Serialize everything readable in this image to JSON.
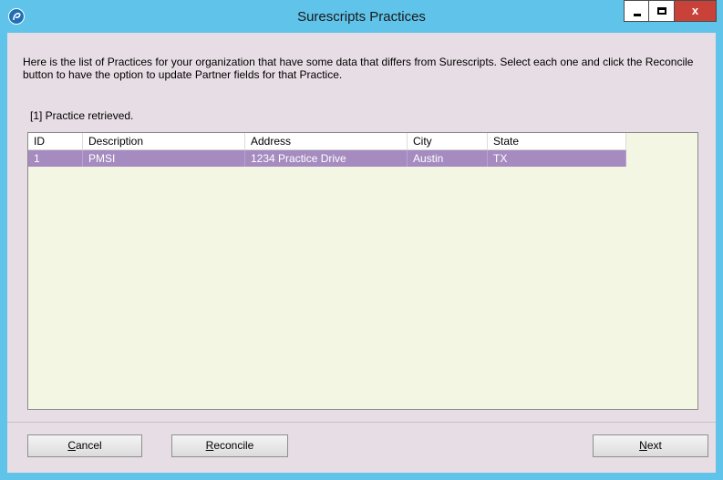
{
  "window": {
    "title": "Surescripts Practices",
    "close_glyph": "x"
  },
  "description": "Here is the list of Practices for your organization that have some data that differs from Surescripts. Select each one and click the Reconcile button to have the option to update Partner fields for that Practice.",
  "status": "[1] Practice retrieved.",
  "table": {
    "columns": [
      "ID",
      "Description",
      "Address",
      "City",
      "State"
    ],
    "rows": [
      [
        "1",
        "PMSI",
        "1234 Practice Drive",
        "Austin",
        "TX"
      ]
    ],
    "selected_row_color": "#a58bbf"
  },
  "buttons": {
    "cancel": {
      "first": "C",
      "rest": "ancel"
    },
    "reconcile": {
      "first": "R",
      "rest": "econcile"
    },
    "next": {
      "first": "N",
      "rest": "ext"
    }
  },
  "colors": {
    "titlebar": "#5fc3ea",
    "client_bg": "#e7dde4",
    "grid_bg": "#f4f6e4",
    "close_button": "#c9423a"
  },
  "icons": {
    "app": "app-logo-icon",
    "minimize": "minimize-icon",
    "maximize": "maximize-icon",
    "close": "close-icon"
  }
}
